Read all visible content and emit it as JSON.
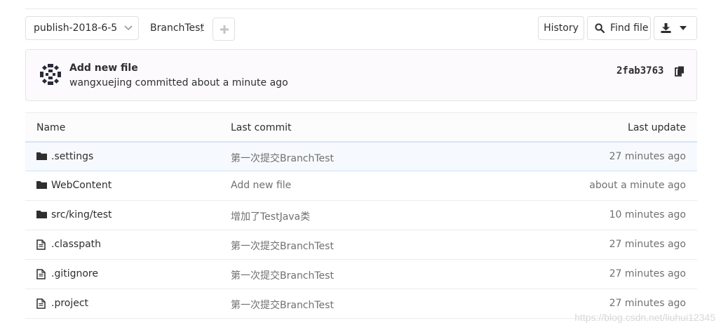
{
  "toolbar": {
    "branch": "publish-2018-6-5",
    "breadcrumb_project": "BranchTest",
    "breadcrumb_separator": "/",
    "history_label": "History",
    "find_file_label": "Find file"
  },
  "last_commit": {
    "title": "Add new file",
    "author_line": "wangxuejing committed about a minute ago",
    "sha": "2fab3763"
  },
  "table": {
    "headers": {
      "name": "Name",
      "last_commit": "Last commit",
      "last_update": "Last update"
    },
    "rows": [
      {
        "type": "folder",
        "name": ".settings",
        "commit": "第一次提交BranchTest",
        "updated": "27 minutes ago"
      },
      {
        "type": "folder",
        "name": "WebContent",
        "commit": "Add new file",
        "updated": "about a minute ago"
      },
      {
        "type": "folder",
        "name": "src/king/test",
        "commit": "增加了TestJava类",
        "updated": "10 minutes ago"
      },
      {
        "type": "file",
        "name": ".classpath",
        "commit": "第一次提交BranchTest",
        "updated": "27 minutes ago"
      },
      {
        "type": "file",
        "name": ".gitignore",
        "commit": "第一次提交BranchTest",
        "updated": "27 minutes ago"
      },
      {
        "type": "file",
        "name": ".project",
        "commit": "第一次提交BranchTest",
        "updated": "27 minutes ago"
      }
    ]
  },
  "watermark": "https://blog.csdn.net/liuhui12345",
  "icons": {
    "folder": "folder-icon",
    "file": "file-icon",
    "search": "search-icon",
    "download": "download-icon",
    "caret": "caret-down-icon",
    "plus": "plus-icon",
    "copy": "copy-icon",
    "chevron": "chevron-down-icon"
  },
  "colors": {
    "panel_bg": "#fcfafd",
    "hover_row_bg": "#f6fafe",
    "border": "#e5e5e5",
    "muted_text": "#707070"
  }
}
